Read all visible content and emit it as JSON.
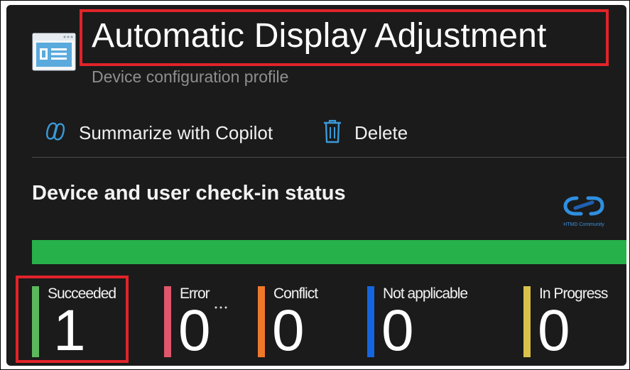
{
  "header": {
    "title": "Automatic Display Adjustment",
    "subtitle": "Device configuration profile"
  },
  "toolbar": {
    "copilot_label": "Summarize with Copilot",
    "delete_label": "Delete"
  },
  "section": {
    "title": "Device and user check-in status"
  },
  "watermark": {
    "text": "HTMD Community"
  },
  "progress": {
    "succeeded_fraction": 1.0
  },
  "stats": [
    {
      "label": "Succeeded",
      "value": "1",
      "color": "#5cb85c"
    },
    {
      "label": "Error",
      "value": "0",
      "color": "#e0566a"
    },
    {
      "label": "Conflict",
      "value": "0",
      "color": "#f0782a"
    },
    {
      "label": "Not applicable",
      "value": "0",
      "color": "#1565e0"
    },
    {
      "label": "In Progress",
      "value": "0",
      "color": "#d9c14a"
    }
  ],
  "colors": {
    "background": "#1b1b1b",
    "highlight": "#e2232a",
    "progress_fill": "#27b14b",
    "accent": "#3a9ad9"
  }
}
